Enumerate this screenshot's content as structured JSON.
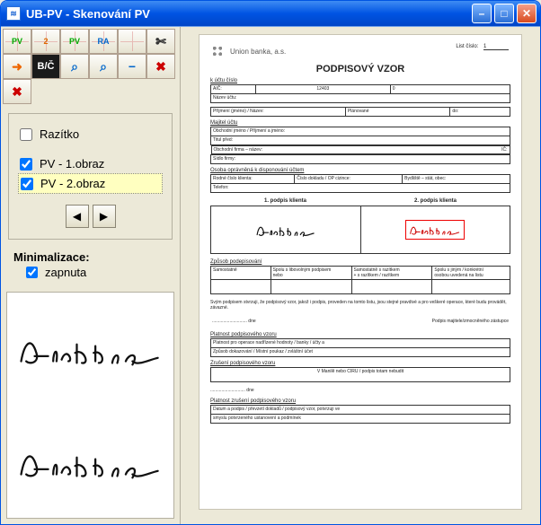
{
  "window": {
    "title": "UB-PV  - Skenování PV"
  },
  "toolbar": {
    "btn_pv": "PV",
    "btn_2": "2",
    "btn_pv2": "PV",
    "btn_ra": "RA",
    "btn_blank": "",
    "btn_cut": "✄",
    "btn_exit": "➜",
    "btn_bc": "B/Č",
    "btn_zoomfit": "⌕",
    "btn_zoom100": "⌕",
    "btn_zoomout": "−",
    "btn_zoomcancel": "✖",
    "btn_zoommove": "✖"
  },
  "options": {
    "razitko_label": "Razítko",
    "razitko_checked": false,
    "pv1_label": "PV - 1.obraz",
    "pv1_checked": true,
    "pv2_label": "PV - 2.obraz",
    "pv2_checked": true,
    "nav_prev": "◀",
    "nav_next": "▶"
  },
  "minimalizace": {
    "title": "Minimalizace:",
    "label": "zapnuta",
    "checked": true
  },
  "document": {
    "bank_name": "Union banka, a.s.",
    "list_label": "List číslo:",
    "list_value": "1",
    "title": "PODPISOVÝ VZOR",
    "section_account": "k účtu číslo",
    "acc_row1_left": "AIČ:",
    "acc_row1_mid": "12403",
    "acc_row1_right": "0",
    "acc_row2": "Název účtu:",
    "owner_left": "Příjmení (jméno) / Název:",
    "owner_mid": "Plánované",
    "owner_right": "do:",
    "section_owner": "Majitel účtu",
    "owner_line1": "Obchodní jméno / Příjmení a jméno:",
    "owner_line2": "Titul před:",
    "owner_line3": "Obchodní firma – název:",
    "owner_line3_right": "IČ:",
    "owner_line4": "Sídlo firmy:",
    "section_disp": "Osoba oprávněná k disponování účtem",
    "disp_left": "Rodné číslo klienta:",
    "disp_mid": "Číslo dokladu / OP cizince:",
    "disp_right": "Bydliště – stát, obec:",
    "disp_row2": "Telefon:",
    "sig1_title": "1. podpis klienta",
    "sig2_title": "2. podpis klienta",
    "sig_name": "Richter",
    "section_ways": "Způsob podepisování",
    "ways_col1": "Samostatně",
    "ways_col2a": "Spolu s libovolným podpisem",
    "ways_col2b": "nebo",
    "ways_col3a": "Samostatně s razítkem",
    "ways_col3b": "+ s razítkem / razítkem",
    "ways_col4a": "Spolu s jiným / konkrétní",
    "ways_col4b": "osobou uvedená na listu",
    "declaration": "Svým podpisem stvrzuji, že podpisový vzor, jakož i podpis, proveden na tomto listu, jsou stejné pravdivé a pro veškeré operace, které budu provádět, závazné.",
    "dots_label": "............................",
    "date_label": "dne",
    "sign_label": "Podpis majitele/zmocněného zástupce",
    "section_valid": "Platnost podpisového vzoru",
    "valid_line1": "Platnost pro operace nadřízené hodnoty / banky / účty a",
    "valid_line2": "Způsob dokazování / Místní poukaz / zvláštní účet",
    "section_cancel": "Zrušení podpisového vzoru",
    "cancel_line1": "V Manilě nebo CIRU / podpis totam nebudit",
    "cancel_date": "dne",
    "section_cancel2": "Platnost zrušení podpisového vzoru",
    "cancel2_line1": "Datum a podpis / převzetí dokladů / podpisový vzor, potvrzuji ve",
    "cancel2_line2": "smyslu potvrzeného ustanovení a podmínek"
  }
}
